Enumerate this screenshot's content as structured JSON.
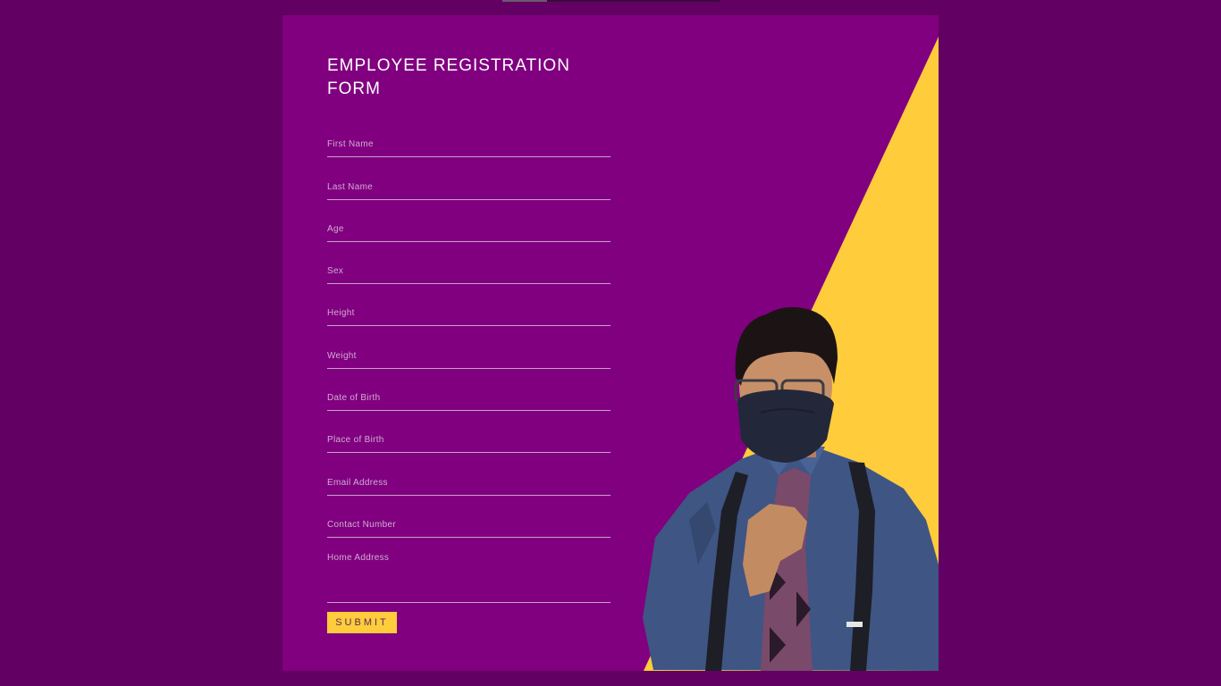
{
  "form": {
    "title": "EMPLOYEE REGISTRATION FORM",
    "fields": [
      {
        "placeholder": "First Name"
      },
      {
        "placeholder": "Last Name"
      },
      {
        "placeholder": "Age"
      },
      {
        "placeholder": "Sex"
      },
      {
        "placeholder": "Height"
      },
      {
        "placeholder": "Weight"
      },
      {
        "placeholder": "Date of Birth"
      },
      {
        "placeholder": "Place of Birth"
      },
      {
        "placeholder": "Email Address"
      },
      {
        "placeholder": "Contact Number"
      }
    ],
    "home_address_placeholder": "Home Address",
    "submit_label": "SUBMIT"
  },
  "colors": {
    "page_background": "#630063",
    "card_background": "#800080",
    "accent": "#ffcc3c",
    "text": "#ffffff"
  },
  "icons": {
    "photo": "person-photo"
  }
}
